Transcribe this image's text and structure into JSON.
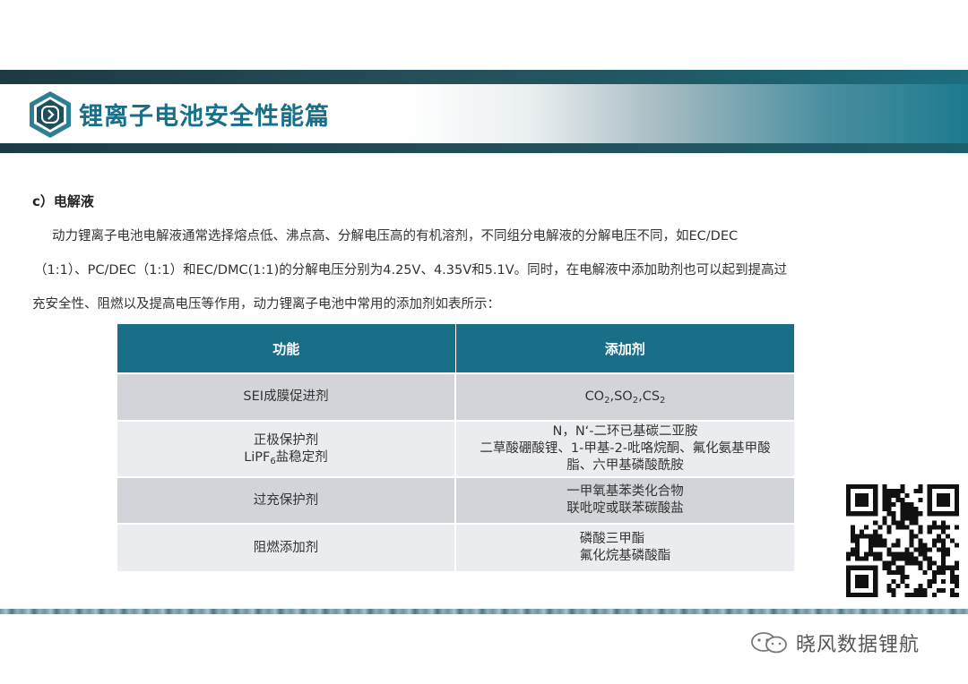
{
  "header": {
    "title": "锂离子电池安全性能篇"
  },
  "section": {
    "heading": "c）电解液",
    "lines": [
      "动力锂离子电池电解液通常选择熔点低、沸点高、分解电压高的有机溶剂，不同组分电解液的分解电压不同，如EC/DEC",
      "（1:1）、PC/DEC（1:1）和EC/DMC(1:1)的分解电压分别为4.25V、4.35V和5.1V。同时，在电解液中添加助剂也可以起到提高过",
      "充安全性、阻燃以及提高电压等作用，动力锂离子电池中常用的添加剂如表所示："
    ]
  },
  "table": {
    "headers": [
      "功能",
      "添加剂"
    ],
    "row1": {
      "function": "SEI成膜促进剂",
      "additive_parts": [
        "CO",
        "2",
        ",SO",
        "2",
        ",CS",
        "2"
      ]
    },
    "row2": {
      "function_line1": "正极保护剂",
      "function_line2_parts": [
        "LiPF",
        "6",
        "盐稳定剂"
      ],
      "additive_lines": [
        "N，N‘-二环已基碳二亚胺",
        "二草酸硼酸锂、1-甲基-2-吡咯烷酮、氟化氨基甲酸",
        "脂、六甲基磷酸酰胺"
      ]
    },
    "row3": {
      "function": "过充保护剂",
      "additive_lines": [
        "一甲氧基苯类化合物",
        "联吡啶或联苯碳酸盐"
      ]
    },
    "row4": {
      "function": "阻燃添加剂",
      "additive_lines": [
        "磷酸三甲酯",
        "氟化烷基磷酸酯"
      ]
    }
  },
  "watermark": {
    "text": "晓风数据锂航",
    "icon": "wechat-icon"
  },
  "icons": {
    "header_badge": "chevron-right-icon",
    "qr": "qr-code-icon"
  },
  "colors": {
    "accent": "#186f87",
    "title": "#1a6f88",
    "row_dark": "#d1d4d8",
    "row_light": "#ebecef"
  }
}
